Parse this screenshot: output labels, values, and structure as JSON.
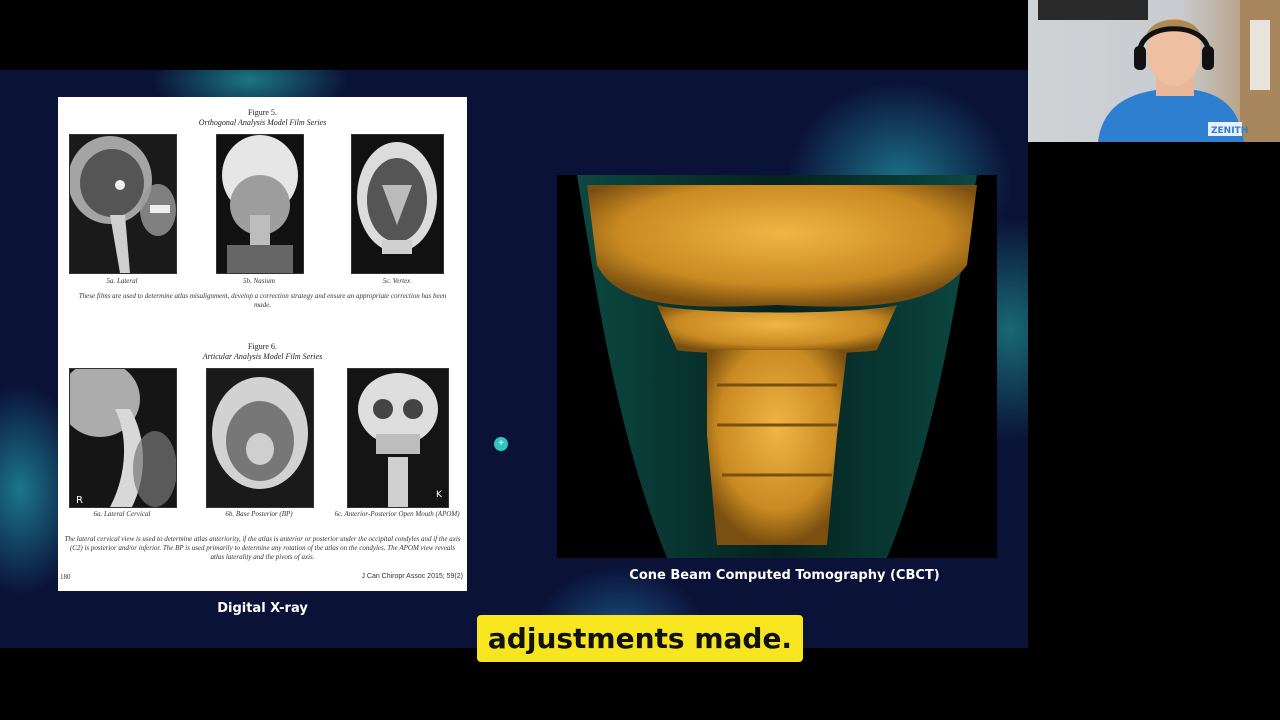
{
  "document": {
    "figure5_title": "Figure 5.",
    "figure5_subtitle": "Orthogonal Analysis Model Film Series",
    "figure5_captions": [
      "5a. Lateral",
      "5b. Nasium",
      "5c. Vertex"
    ],
    "figure5_text": "These films are used to determine atlas misalignment, develop a correction strategy and ensure an appropriate correction has been made.",
    "figure6_title": "Figure 6.",
    "figure6_subtitle": "Articular Analysis Model Film Series",
    "figure6_captions": [
      "6a. Lateral Cervical",
      "6b. Base Posterior (BP)",
      "6c. Anterior-Posterior Open Mouth (APOM)"
    ],
    "figure6_text": "The lateral cervical view is used to determine atlas anteriority, if the atlas is anterior or posterior under the occipital condyles and if the axis (C2) is posterior and/or inferior. The BP is used primarily to determine any rotation of the atlas on the condyles. The APOM view reveals atlas laterality and the pivots of axis.",
    "page_number": "180",
    "citation": "J Can Chiropr Assoc 2015; 59(2)"
  },
  "labels": {
    "left": "Digital X-ray",
    "right": "Cone Beam Computed Tomography (CBCT)"
  },
  "caption": "adjustments made.",
  "webcam": {
    "logo": "ZENITH"
  },
  "colors": {
    "slide_bg": "#0b1238",
    "accent_teal": "#2ec6c0",
    "caption_bg": "#f7e51f",
    "bone": "#d99a2b"
  }
}
